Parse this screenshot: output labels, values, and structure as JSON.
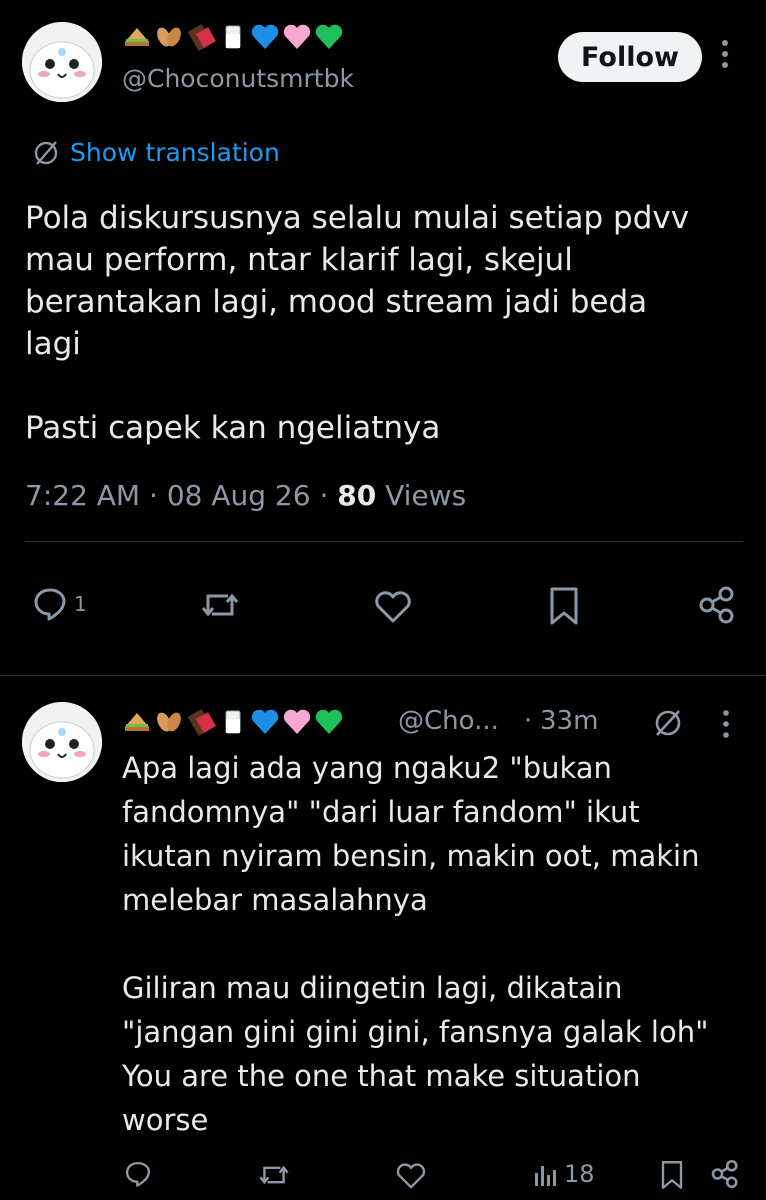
{
  "tweet": {
    "handle": "@Choconutsmrtbk",
    "follow_label": "Follow",
    "translate_label": "Show translation",
    "text": "Pola diskursusnya selalu mulai setiap pdvv\nmau perform, ntar klarif lagi, skejul\nberantakan lagi, mood stream jadi beda\nlagi\n\nPasti capek kan ngeliatnya",
    "time": "7:22 AM",
    "date": "08 Aug 26",
    "views_count": "80",
    "views_label": "Views",
    "reply_count": "1"
  },
  "reply": {
    "handle": "@Cho...",
    "age": "33m",
    "text": "Apa lagi ada yang ngaku2 \"bukan\nfandomnya\" \"dari luar fandom\" ikut\nikutan nyiram bensin, makin oot, makin\nmelebar masalahnya\n\nGiliran mau diingetin lagi, dikatain\n\"jangan gini gini gini, fansnya galak loh\"\nYou are the one that make situation\nworse",
    "views_count": "18"
  },
  "icons": {
    "name_emojis": [
      "sandwich-icon",
      "peanuts-icon",
      "chocolate-icon",
      "milk-icon",
      "blue-heart-icon",
      "pink-heart-icon",
      "green-heart-icon"
    ]
  },
  "colors": {
    "background": "#000000",
    "accent": "#1d9bf0",
    "muted": "#8b98a5",
    "divider": "#2f3336"
  }
}
